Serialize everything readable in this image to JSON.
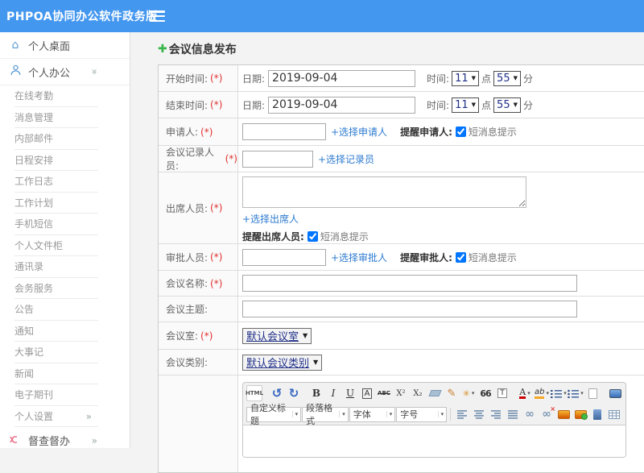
{
  "header": {
    "title": "PHPOA协同办公软件政务版"
  },
  "sidebar": {
    "desktop_label": "个人桌面",
    "office_label": "个人办公",
    "submenu": [
      "在线考勤",
      "消息管理",
      "内部邮件",
      "日程安排",
      "工作日志",
      "工作计划",
      "手机短信",
      "个人文件柜",
      "通讯录",
      "会务服务",
      "公告",
      "通知",
      "大事记",
      "新闻",
      "电子期刊",
      "个人设置"
    ],
    "supervise_label": "督查督办"
  },
  "page": {
    "title": "会议信息发布"
  },
  "form": {
    "required_mark": "(*)",
    "start_time": {
      "label": "开始时间:",
      "date_label": "日期:",
      "date_value": "2019-09-04",
      "time_label": "时间:",
      "hour": "11",
      "hour_unit": "点",
      "minute": "55",
      "minute_unit": "分"
    },
    "end_time": {
      "label": "结束时间:",
      "date_label": "日期:",
      "date_value": "2019-09-04",
      "time_label": "时间:",
      "hour": "11",
      "hour_unit": "点",
      "minute": "55",
      "minute_unit": "分"
    },
    "applicant": {
      "label": "申请人:",
      "link": "+选择申请人",
      "remind_label": "提醒申请人:",
      "sms_label": "短消息提示"
    },
    "recorder": {
      "label": "会议记录人员:",
      "link": "+选择记录员"
    },
    "attendees": {
      "label": "出席人员:",
      "link": "+选择出席人",
      "remind_label": "提醒出席人员:",
      "sms_label": "短消息提示"
    },
    "approver": {
      "label": "审批人员:",
      "link": "+选择审批人",
      "remind_label": "提醒审批人:",
      "sms_label": "短消息提示"
    },
    "meeting_name": {
      "label": "会议名称:"
    },
    "meeting_subject": {
      "label": "会议主题:"
    },
    "meeting_room": {
      "label": "会议室:",
      "value": "默认会议室"
    },
    "meeting_category": {
      "label": "会议类别:",
      "value": "默认会议类别"
    }
  },
  "editor": {
    "html_label": "HTML",
    "bold_label": "B",
    "italic_label": "I",
    "underline_label": "U",
    "boxed_a_label": "A",
    "strike_label": "ABC",
    "sup_label": "X²",
    "sub_label": "X₂",
    "quote_label": "66",
    "paste_label": "T",
    "fontcolor_label": "A",
    "highlight_label": "ab",
    "heading_select": "自定义标题",
    "format_select": "段落格式",
    "font_select": "字体",
    "size_select": "字号"
  },
  "colors": {
    "header_blue": "#4497ef",
    "link_blue": "#2d7bd0",
    "required_red": "#e0312f",
    "plus_green": "#3ab54a",
    "select_navy": "#1f2f87"
  }
}
